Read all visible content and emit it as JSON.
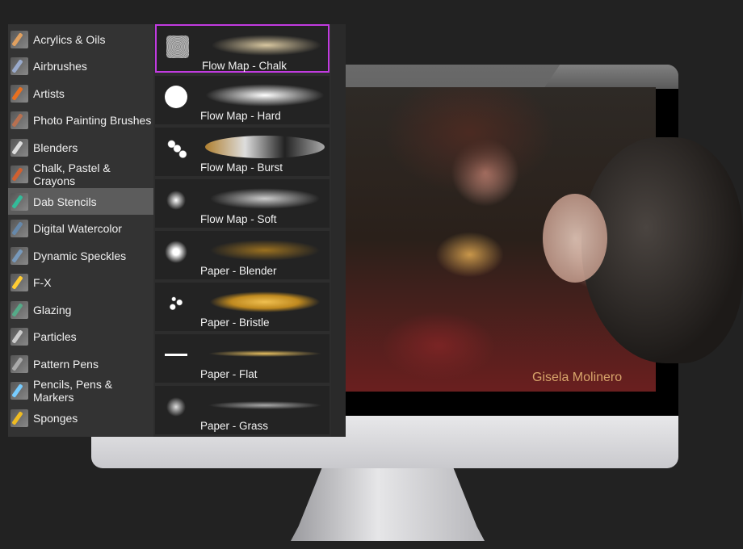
{
  "categories": [
    {
      "label": "Acrylics & Oils",
      "icon": "acrylics-brush-icon"
    },
    {
      "label": "Airbrushes",
      "icon": "airbrush-icon"
    },
    {
      "label": "Artists",
      "icon": "artists-brush-icon"
    },
    {
      "label": "Photo Painting Brushes",
      "icon": "photo-painting-icon"
    },
    {
      "label": "Blenders",
      "icon": "blender-icon"
    },
    {
      "label": "Chalk, Pastel & Crayons",
      "icon": "chalk-icon"
    },
    {
      "label": "Dab Stencils",
      "icon": "dab-stencil-icon",
      "selected": true
    },
    {
      "label": "Digital Watercolor",
      "icon": "watercolor-icon"
    },
    {
      "label": "Dynamic Speckles",
      "icon": "speckles-icon"
    },
    {
      "label": "F-X",
      "icon": "fx-star-icon"
    },
    {
      "label": "Glazing",
      "icon": "glazing-icon"
    },
    {
      "label": "Particles",
      "icon": "particles-icon"
    },
    {
      "label": "Pattern Pens",
      "icon": "pattern-pen-icon"
    },
    {
      "label": "Pencils, Pens & Markers",
      "icon": "pencil-icon"
    },
    {
      "label": "Sponges",
      "icon": "sponge-icon"
    }
  ],
  "brushes": [
    {
      "label": "Flow Map - Chalk",
      "selected": true
    },
    {
      "label": "Flow Map - Hard"
    },
    {
      "label": "Flow Map - Burst"
    },
    {
      "label": "Flow Map - Soft"
    },
    {
      "label": "Paper - Blender"
    },
    {
      "label": "Paper - Bristle"
    },
    {
      "label": "Paper - Flat"
    },
    {
      "label": "Paper - Grass"
    }
  ],
  "artwork": {
    "signature": "Gisela Molinero"
  },
  "colors": {
    "selection": "#c13be0",
    "selected_category": "#5c5c5c"
  }
}
